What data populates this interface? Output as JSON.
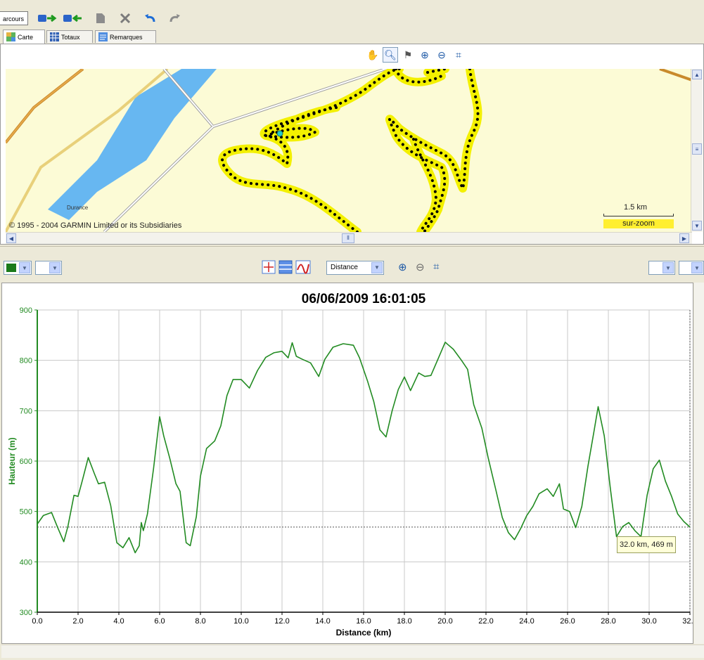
{
  "toolbar": {
    "parcours_label": "arcours",
    "icons": [
      "route-export-icon",
      "route-import-icon",
      "document-icon",
      "delete-icon",
      "undo-icon",
      "redo-icon"
    ]
  },
  "tabs": [
    {
      "label": "Carte",
      "icon": "map-icon",
      "active": true
    },
    {
      "label": "Totaux",
      "icon": "table-icon",
      "active": false
    },
    {
      "label": "Remarques",
      "icon": "notes-icon",
      "active": false
    }
  ],
  "map": {
    "tools": [
      "hand-icon",
      "magnifier-icon",
      "flag-icon",
      "zoom-in-icon",
      "zoom-out-icon",
      "fit-icon"
    ],
    "copyright": "© 1995 - 2004 GARMIN Limited or its Subsidiaries",
    "river_label": "Durance",
    "scale_label": "1.5 km",
    "zoom_badge": "sur-zoom",
    "colors": {
      "background": "#fcfbd6",
      "water": "#67b7f1",
      "track_halo": "#f3f000",
      "track_dots": "#000000",
      "cursor": "#26c9c9"
    }
  },
  "profile_toolbar": {
    "color_swatch": "#1a7a1a",
    "x_axis_select": "Distance",
    "icons": [
      "crosshair-icon",
      "bands-icon",
      "curve-icon",
      "zoom-in-icon",
      "zoom-out-icon",
      "fit-icon"
    ]
  },
  "chart_data": {
    "type": "line",
    "title": "06/06/2009 16:01:05",
    "xlabel": "Distance (km)",
    "ylabel": "Hauteur (m)",
    "xlim": [
      0,
      32
    ],
    "ylim": [
      300,
      900
    ],
    "xticks": [
      "0.0",
      "2.0",
      "4.0",
      "6.0",
      "8.0",
      "10.0",
      "12.0",
      "14.0",
      "16.0",
      "18.0",
      "20.0",
      "22.0",
      "24.0",
      "26.0",
      "28.0",
      "30.0",
      "32.0"
    ],
    "yticks": [
      "300",
      "400",
      "500",
      "600",
      "700",
      "800",
      "900"
    ],
    "grid": true,
    "line_color": "#228b22",
    "cursor": {
      "x": 32.0,
      "y": 469,
      "label": "32.0 km, 469 m"
    },
    "series": [
      {
        "x": [
          0,
          0.3,
          0.7,
          1.0,
          1.3,
          1.5,
          1.8,
          2.0,
          2.2,
          2.5,
          2.8,
          3.0,
          3.3,
          3.6,
          3.9,
          4.2,
          4.5,
          4.8,
          5.0,
          5.1,
          5.2,
          5.4,
          5.7,
          6.0,
          6.2,
          6.5,
          6.8,
          7.0,
          7.3,
          7.5,
          7.8,
          8.0,
          8.3,
          8.7,
          9.0,
          9.3,
          9.6,
          10.0,
          10.4,
          10.8,
          11.2,
          11.6,
          12.0,
          12.3,
          12.5,
          12.7,
          13.0,
          13.4,
          13.8,
          14.1,
          14.5,
          15.0,
          15.5,
          15.8,
          16.2,
          16.5,
          16.8,
          17.1,
          17.4,
          17.7,
          18.0,
          18.3,
          18.7,
          19.0,
          19.3,
          19.6,
          20.0,
          20.4,
          20.8,
          21.1,
          21.4,
          21.8,
          22.1,
          22.5,
          22.8,
          23.1,
          23.4,
          23.7,
          24.0,
          24.3,
          24.6,
          25.0,
          25.3,
          25.6,
          25.8,
          26.1,
          26.4,
          26.7,
          27.0,
          27.3,
          27.5,
          27.8,
          28.1,
          28.4,
          28.7,
          29.0,
          29.3,
          29.6,
          29.9,
          30.2,
          30.5,
          30.8,
          31.1,
          31.4,
          31.7,
          32.0
        ],
        "values": [
          475,
          492,
          498,
          468,
          440,
          470,
          532,
          530,
          560,
          607,
          575,
          555,
          558,
          512,
          438,
          428,
          448,
          418,
          432,
          478,
          462,
          495,
          585,
          688,
          650,
          605,
          555,
          540,
          438,
          432,
          490,
          570,
          625,
          640,
          670,
          730,
          762,
          762,
          745,
          780,
          806,
          815,
          818,
          805,
          835,
          808,
          802,
          795,
          768,
          802,
          826,
          833,
          830,
          805,
          758,
          718,
          662,
          648,
          700,
          742,
          767,
          740,
          775,
          768,
          770,
          798,
          836,
          822,
          800,
          782,
          712,
          665,
          608,
          540,
          488,
          458,
          444,
          466,
          492,
          510,
          535,
          545,
          530,
          555,
          505,
          500,
          468,
          510,
          590,
          660,
          708,
          650,
          545,
          450,
          470,
          478,
          462,
          450,
          532,
          585,
          602,
          560,
          530,
          495,
          480,
          469
        ]
      }
    ]
  }
}
